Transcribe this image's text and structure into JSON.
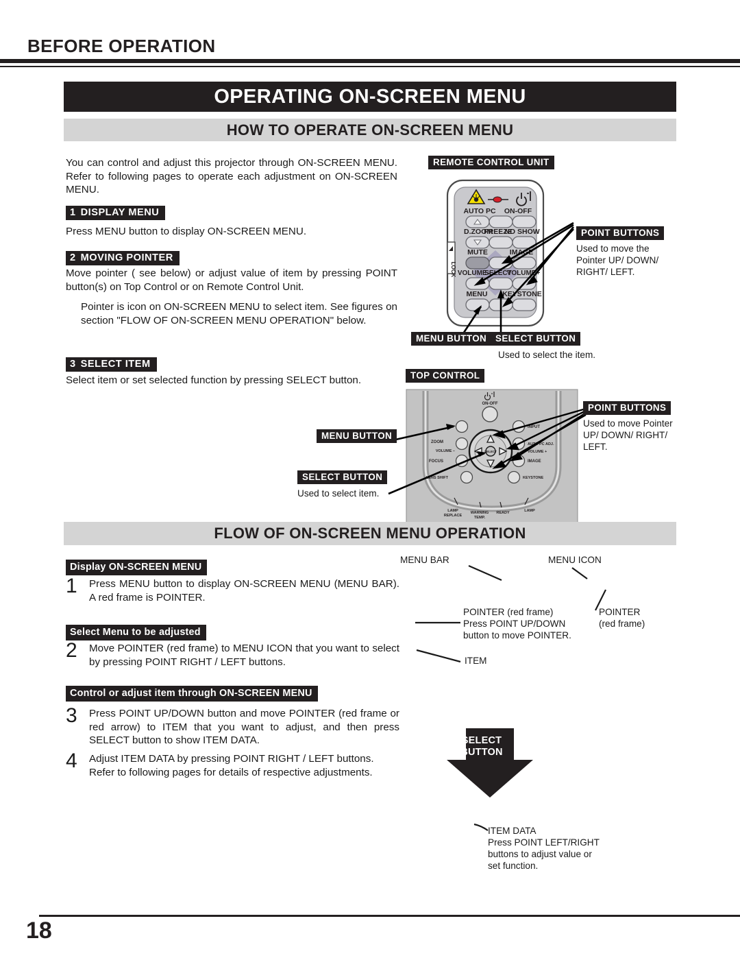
{
  "running_head": "BEFORE OPERATION",
  "page_number": "18",
  "banners": {
    "title": "OPERATING ON-SCREEN MENU",
    "section1": "HOW TO OPERATE ON-SCREEN MENU",
    "section2": "FLOW OF ON-SCREEN MENU OPERATION"
  },
  "intro": "You can control and adjust this projector through ON-SCREEN MENU.  Refer to following pages to operate each adjustment on ON-SCREEN MENU.",
  "steps": [
    {
      "num": "1",
      "tag": "DISPLAY MENU",
      "body": "Press MENU button to display ON-SCREEN MENU."
    },
    {
      "num": "2",
      "tag": "MOVING POINTER",
      "body": "Move pointer (   see below) or adjust value of item by pressing POINT button(s) on Top Control or on Remote Control Unit.",
      "note": "Pointer is icon on ON-SCREEN MENU to select item.  See figures on section \"FLOW OF ON-SCREEN MENU OPERATION\" below."
    },
    {
      "num": "3",
      "tag": "SELECT ITEM",
      "body": "Select item or set selected function by pressing SELECT button."
    }
  ],
  "remote": {
    "title": "REMOTE CONTROL UNIT",
    "side_label": "LOCK",
    "buttons": [
      "AUTO PC",
      "ON-OFF",
      "D.ZOOM",
      "FREEZE",
      "NO SHOW",
      "MUTE",
      "IMAGE",
      "VOLUME–",
      "SELECT",
      "VOLUME+",
      "MENU",
      "KEYSTONE"
    ],
    "callouts": [
      {
        "chip": "POINT BUTTONS",
        "caption": "Used to move the\nPointer UP/ DOWN/\nRIGHT/ LEFT."
      },
      {
        "chip": "MENU BUTTON",
        "caption": ""
      },
      {
        "chip": "SELECT BUTTON",
        "caption": "Used to select the item."
      }
    ]
  },
  "top_control": {
    "title": "TOP CONTROL",
    "buttons": [
      "ON-OFF",
      "INPUT",
      "ZOOM",
      "AUTO PC ADJ.",
      "VOLUME –",
      "VOLUME +",
      "FOCUS",
      "IMAGE",
      "LENS SHIFT",
      "KEYSTONE",
      "SELECT"
    ],
    "indicators": [
      "LAMP REPLACE",
      "WARNING TEMP.",
      "READY",
      "LAMP"
    ],
    "callouts": [
      {
        "chip": "POINT BUTTONS",
        "caption": "Used to move Pointer\nUP/ DOWN/ RIGHT/\nLEFT."
      },
      {
        "chip": "MENU BUTTON",
        "caption": ""
      },
      {
        "chip": "SELECT BUTTON",
        "caption": "Used to select item."
      }
    ]
  },
  "flow": {
    "steps": [
      {
        "num": "1",
        "tag": "Display ON-SCREEN MENU",
        "body": "Press MENU button to display ON-SCREEN MENU (MENU BAR).  A red frame is POINTER."
      },
      {
        "num": "2",
        "tag": "Select Menu to be adjusted",
        "body": "Move POINTER (red frame) to MENU ICON that you want to select by pressing POINT RIGHT / LEFT buttons."
      },
      {
        "num": "3",
        "tag": "Control or adjust item through ON-SCREEN MENU",
        "body": "Press POINT UP/DOWN button and move POINTER (red frame or red arrow) to ITEM that you want to adjust, and then press SELECT button to show ITEM DATA."
      },
      {
        "num": "4",
        "tag": "",
        "body": "Adjust ITEM DATA by pressing POINT RIGHT / LEFT buttons.\nRefer to following pages for details of respective adjustments."
      }
    ],
    "callouts": {
      "menu_bar": "MENU BAR",
      "menu_icon": "MENU ICON",
      "pointer_block_l1": "POINTER (red frame)",
      "pointer_block_l2": "Press  POINT  UP/DOWN",
      "pointer_block_l3": "button to move POINTER.",
      "pointer_right_l1": "POINTER",
      "pointer_right_l2": "(red frame)",
      "item": "ITEM",
      "item_data_l1": "ITEM DATA",
      "item_data_l2": "Press POINT LEFT/RIGHT",
      "item_data_l3": "buttons to adjust value or",
      "item_data_l4": "set function."
    },
    "select_arrow": {
      "line1": "SELECT",
      "line2": "BUTTON"
    }
  },
  "colors": {
    "ink": "#231f20",
    "banner_gray": "#d4d4d4",
    "remote_body": "#ffffff",
    "remote_face": "#c9c9cd",
    "button_fill": "#dcdce0",
    "point_diamond": "#a6a2bd",
    "warning_yellow": "#f5e000",
    "led_red": "#d4202a",
    "panel_gray": "#c0c0c0",
    "handle_gray": "#9a9a9a"
  }
}
